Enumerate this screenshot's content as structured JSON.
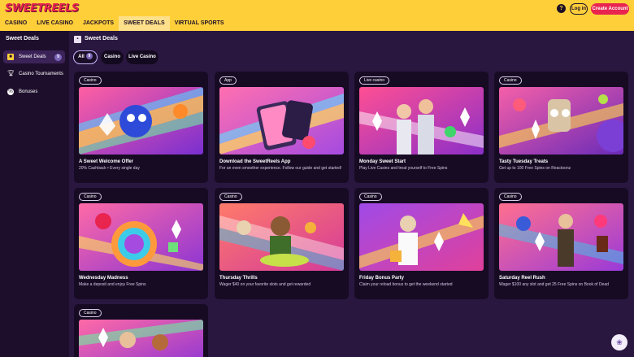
{
  "header": {
    "logo_text": "SWEETREELS",
    "nav": [
      "CASINO",
      "LIVE CASINO",
      "JACKPOTS",
      "SWEET DEALS",
      "VIRTUAL SPORTS"
    ],
    "help_label": "?",
    "login_label": "Log in",
    "create_label": "Create Account"
  },
  "sidebar": {
    "title": "Sweet Deals",
    "items": [
      {
        "label": "Sweet Deals",
        "badge": "9",
        "icon": "gift-icon"
      },
      {
        "label": "Casino Tournaments",
        "icon": "trophy-icon"
      },
      {
        "label": "Bonuses",
        "icon": "bonus-icon"
      }
    ]
  },
  "main": {
    "title": "Sweet Deals",
    "filters": [
      {
        "label": "All",
        "count": "9"
      },
      {
        "label": "Casino"
      },
      {
        "label": "Live Casino"
      }
    ],
    "cards": [
      {
        "tag": "Casino",
        "title": "A Sweet Welcome Offer",
        "desc": "20% Cashback • Every single day"
      },
      {
        "tag": "App",
        "title": "Download the SweetReels App",
        "desc": "For an even smoother experience. Follow our guide and get started!"
      },
      {
        "tag": "Live casino",
        "title": "Monday Sweet Start",
        "desc": "Play Live Casino and treat yourself to Free Spins"
      },
      {
        "tag": "Casino",
        "title": "Tasty Tuesday Treats",
        "desc": "Get up to 100 Free Spins on Reactoonz"
      },
      {
        "tag": "Casino",
        "title": "Wednesday Madness",
        "desc": "Make a deposit and enjoy Free Spins"
      },
      {
        "tag": "Casino",
        "title": "Thursday Thrills",
        "desc": "Wager $40 on your favorite slots and get rewarded"
      },
      {
        "tag": "Casino",
        "title": "Friday Bonus Party",
        "desc": "Claim your reload bonus to get the weekend started"
      },
      {
        "tag": "Casino",
        "title": "Saturday Reel Rush",
        "desc": "Wager $100 any slot and get 25 Free Spins on Book of Dead"
      },
      {
        "tag": "Casino",
        "title": "",
        "desc": ""
      }
    ]
  }
}
